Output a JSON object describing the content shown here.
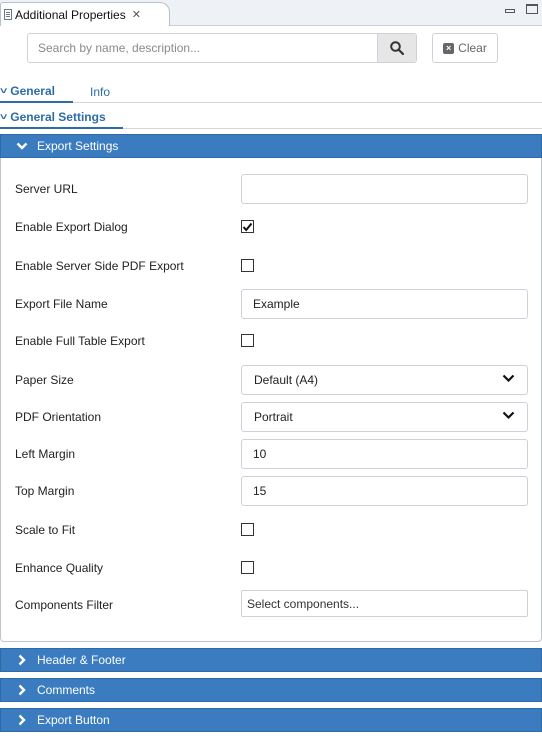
{
  "view": {
    "title": "Additional Properties",
    "close_glyph": "✕"
  },
  "search": {
    "placeholder": "Search by name, description...",
    "value": "",
    "clear_label": "Clear"
  },
  "tabs": {
    "general": "General",
    "info": "Info"
  },
  "section": {
    "label": "General Settings"
  },
  "export_settings": {
    "header": "Export Settings",
    "rows": {
      "server_url": {
        "label": "Server URL",
        "value": ""
      },
      "enable_export_dialog": {
        "label": "Enable Export Dialog",
        "checked": true
      },
      "server_side_pdf": {
        "label": "Enable Server Side PDF Export",
        "checked": false
      },
      "export_file_name": {
        "label": "Export File Name",
        "value": "Example"
      },
      "full_table_export": {
        "label": "Enable Full Table Export",
        "checked": false
      },
      "paper_size": {
        "label": "Paper Size",
        "value": "Default (A4)"
      },
      "pdf_orientation": {
        "label": "PDF Orientation",
        "value": "Portrait"
      },
      "left_margin": {
        "label": "Left Margin",
        "value": "10"
      },
      "top_margin": {
        "label": "Top Margin",
        "value": "15"
      },
      "scale_to_fit": {
        "label": "Scale to Fit",
        "checked": false
      },
      "enhance_quality": {
        "label": "Enhance Quality",
        "checked": false
      },
      "components_filter": {
        "label": "Components Filter",
        "value": "Select components..."
      }
    }
  },
  "panels": {
    "header_footer": "Header & Footer",
    "comments": "Comments",
    "export_button": "Export Button"
  },
  "colors": {
    "accent": "#2d6ca8",
    "panel_header": "#3a7cbf"
  }
}
